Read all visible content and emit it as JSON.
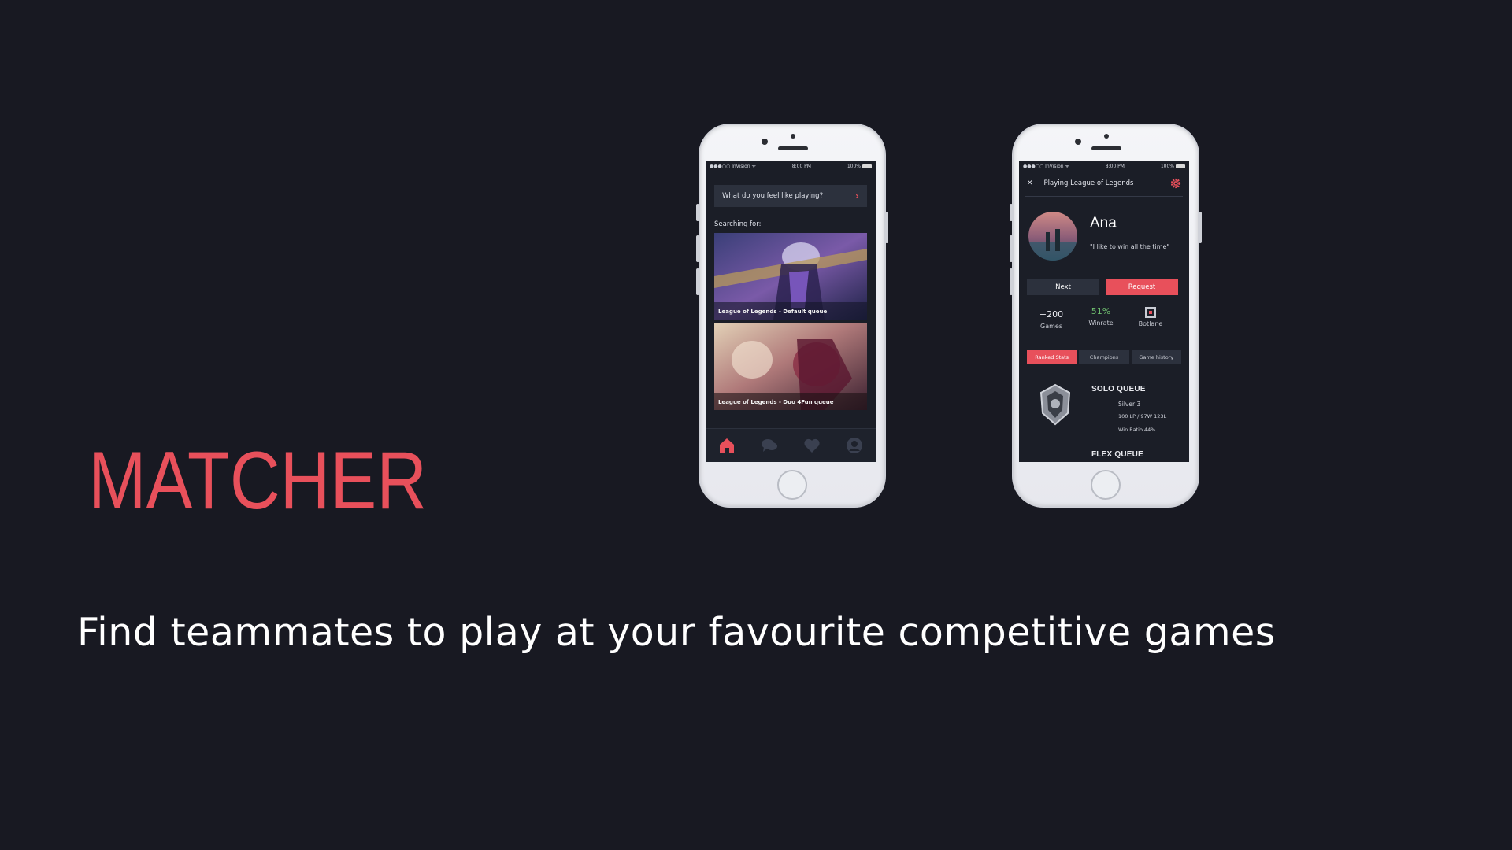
{
  "colors": {
    "background": "#181922",
    "accent": "#e8505b",
    "winrate": "#6fbf6f"
  },
  "brand": {
    "logo_text": "MATCHER"
  },
  "tagline": "Find teammates to play at your favourite competitive games",
  "phone1": {
    "status": {
      "carrier": "●●●○○ InVision ᯤ",
      "time": "8:00 PM",
      "battery": "100%"
    },
    "search_prompt": "What do you feel like playing?",
    "searching_label": "Searching for:",
    "cards": [
      {
        "caption": "League of Legends - Default queue"
      },
      {
        "caption": "League of Legends - Duo 4Fun queue"
      }
    ],
    "nav": [
      "home-icon",
      "chat-icon",
      "heart-icon",
      "profile-icon"
    ]
  },
  "phone2": {
    "status": {
      "carrier": "●●●○○ InVision ᯤ",
      "time": "8:00 PM",
      "battery": "100%"
    },
    "header_title": "Playing League of Legends",
    "close_glyph": "✕",
    "name": "Ana",
    "quote": "\"I like to win all the time\"",
    "buttons": {
      "next": "Next",
      "request": "Request"
    },
    "stats": [
      {
        "value": "+200",
        "label": "Games"
      },
      {
        "value": "51%",
        "label": "Winrate"
      },
      {
        "value": "",
        "label": "Botlane"
      }
    ],
    "tabs": [
      "Ranked Stats",
      "Champions",
      "Game history"
    ],
    "solo": {
      "title": "SOLO QUEUE",
      "rank": "Silver 3",
      "lp": "100 LP / 97W 123L",
      "winratio": "Win Ratio 44%"
    },
    "flex": {
      "title": "FLEX QUEUE"
    }
  }
}
